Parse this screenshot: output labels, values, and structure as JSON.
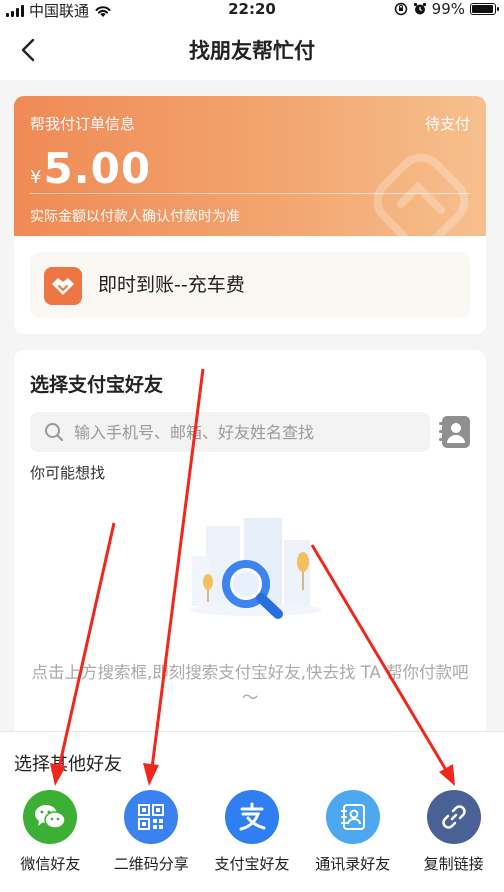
{
  "status_bar": {
    "carrier": "中国联通",
    "time": "22:20",
    "battery": "99%",
    "battery_level": 0.99
  },
  "nav": {
    "title": "找朋友帮忙付",
    "back_icon": "chevron-left-icon"
  },
  "order": {
    "label": "帮我付订单信息",
    "status": "待支付",
    "currency": "¥",
    "amount": "5.00",
    "note": "实际金额以付款人确认付款时为准",
    "item_name": "即时到账--充车费",
    "colors": {
      "gradient_start": "#ef8a55",
      "gradient_end": "#f6c08e",
      "item_icon": "#ee7642"
    }
  },
  "friends": {
    "heading": "选择支付宝好友",
    "search_placeholder": "输入手机号、邮箱、好友姓名查找",
    "suggest_label": "你可能想找",
    "empty_text": "点击上方搜索框,即刻搜索支付宝好友,快去找 TA 帮你付款吧～"
  },
  "other": {
    "heading": "选择其他好友",
    "options": [
      {
        "label": "微信好友",
        "icon": "wechat-icon",
        "color": "#3cb034"
      },
      {
        "label": "二维码分享",
        "icon": "qrcode-icon",
        "color": "#3b82f0"
      },
      {
        "label": "支付宝好友",
        "icon": "alipay-icon",
        "color": "#2f7ef2"
      },
      {
        "label": "通讯录好友",
        "icon": "address-book-icon",
        "color": "#4ea8f0"
      },
      {
        "label": "复制链接",
        "icon": "link-icon",
        "color": "#4a6195"
      }
    ]
  },
  "annotation": {
    "arrow_color": "#f2271c"
  }
}
